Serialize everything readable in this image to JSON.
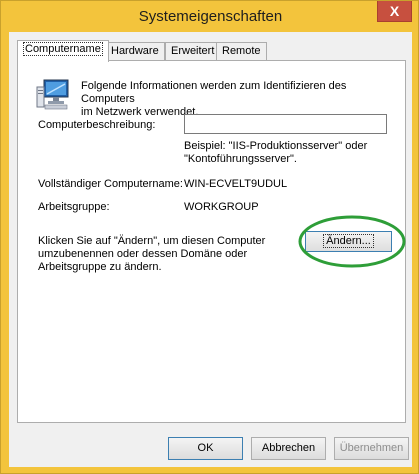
{
  "window": {
    "title": "Systemeigenschaften",
    "close_label": "X"
  },
  "tabs": [
    {
      "label": "Computername"
    },
    {
      "label": "Hardware"
    },
    {
      "label": "Erweitert"
    },
    {
      "label": "Remote"
    }
  ],
  "panel": {
    "intro_line1": "Folgende Informationen werden zum Identifizieren des Computers",
    "intro_line2": "im Netzwerk verwendet.",
    "description_label": "Computerbeschreibung:",
    "description_value": "",
    "example_line1": "Beispiel: \"IIS-Produktionsserver\" oder",
    "example_line2": "\"Kontoführungsserver\".",
    "fullname_label": "Vollständiger Computername:",
    "fullname_value": "WIN-ECVELT9UDUL",
    "workgroup_label": "Arbeitsgruppe:",
    "workgroup_value": "WORKGROUP",
    "change_text_line1": "Klicken Sie auf \"Ändern\", um diesen Computer",
    "change_text_line2": "umzubenennen oder dessen Domäne oder",
    "change_text_line3": "Arbeitsgruppe zu ändern.",
    "change_button": "Ändern..."
  },
  "buttons": {
    "ok": "OK",
    "cancel": "Abbrechen",
    "apply": "Übernehmen"
  },
  "colors": {
    "titlebar": "#f3c43c",
    "close": "#c7503f",
    "highlight_oval": "#2e9e38"
  },
  "icons": {
    "computer": "computer-icon",
    "close": "close-icon"
  }
}
